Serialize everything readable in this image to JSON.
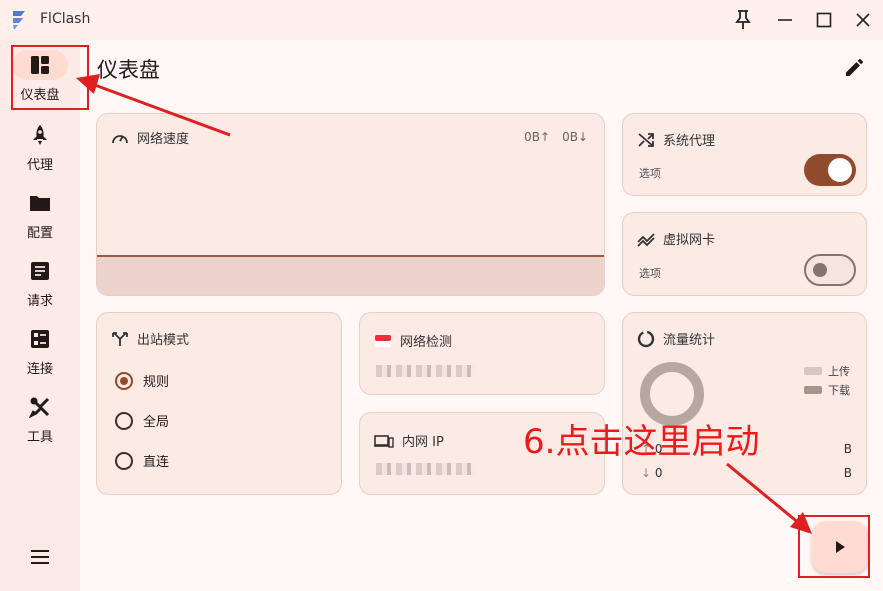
{
  "app": {
    "title": "FlClash"
  },
  "sidebar": {
    "items": [
      {
        "label": "仪表盘",
        "icon": "dashboard-icon",
        "active": true
      },
      {
        "label": "代理",
        "icon": "rocket-icon"
      },
      {
        "label": "配置",
        "icon": "folder-icon"
      },
      {
        "label": "请求",
        "icon": "request-list-icon"
      },
      {
        "label": "连接",
        "icon": "connections-icon"
      },
      {
        "label": "工具",
        "icon": "tools-icon"
      }
    ],
    "menu_icon": "hamburger-menu-icon"
  },
  "header": {
    "title": "仪表盘",
    "edit_icon": "pencil-icon"
  },
  "network_speed": {
    "title": "网络速度",
    "upload": "0B↑",
    "download": "0B↓"
  },
  "system_proxy": {
    "title": "系统代理",
    "sub": "选项",
    "enabled": true
  },
  "virtual_nic": {
    "title": "虚拟网卡",
    "sub": "选项",
    "enabled": false
  },
  "outbound_mode": {
    "title": "出站模式",
    "options": [
      {
        "label": "规则",
        "selected": true
      },
      {
        "label": "全局",
        "selected": false
      },
      {
        "label": "直连",
        "selected": false
      }
    ]
  },
  "network_check": {
    "title": "网络检测"
  },
  "intranet_ip": {
    "title": "内网 IP"
  },
  "traffic_stats": {
    "title": "流量统计",
    "legend": [
      "上传",
      "下载"
    ],
    "upload_value": "0",
    "upload_unit": "B",
    "download_value": "0",
    "download_unit": "B"
  },
  "annotation": {
    "text": "6.点击这里启动"
  },
  "colors": {
    "accent": "#914a2c",
    "annotation": "#e02020"
  }
}
